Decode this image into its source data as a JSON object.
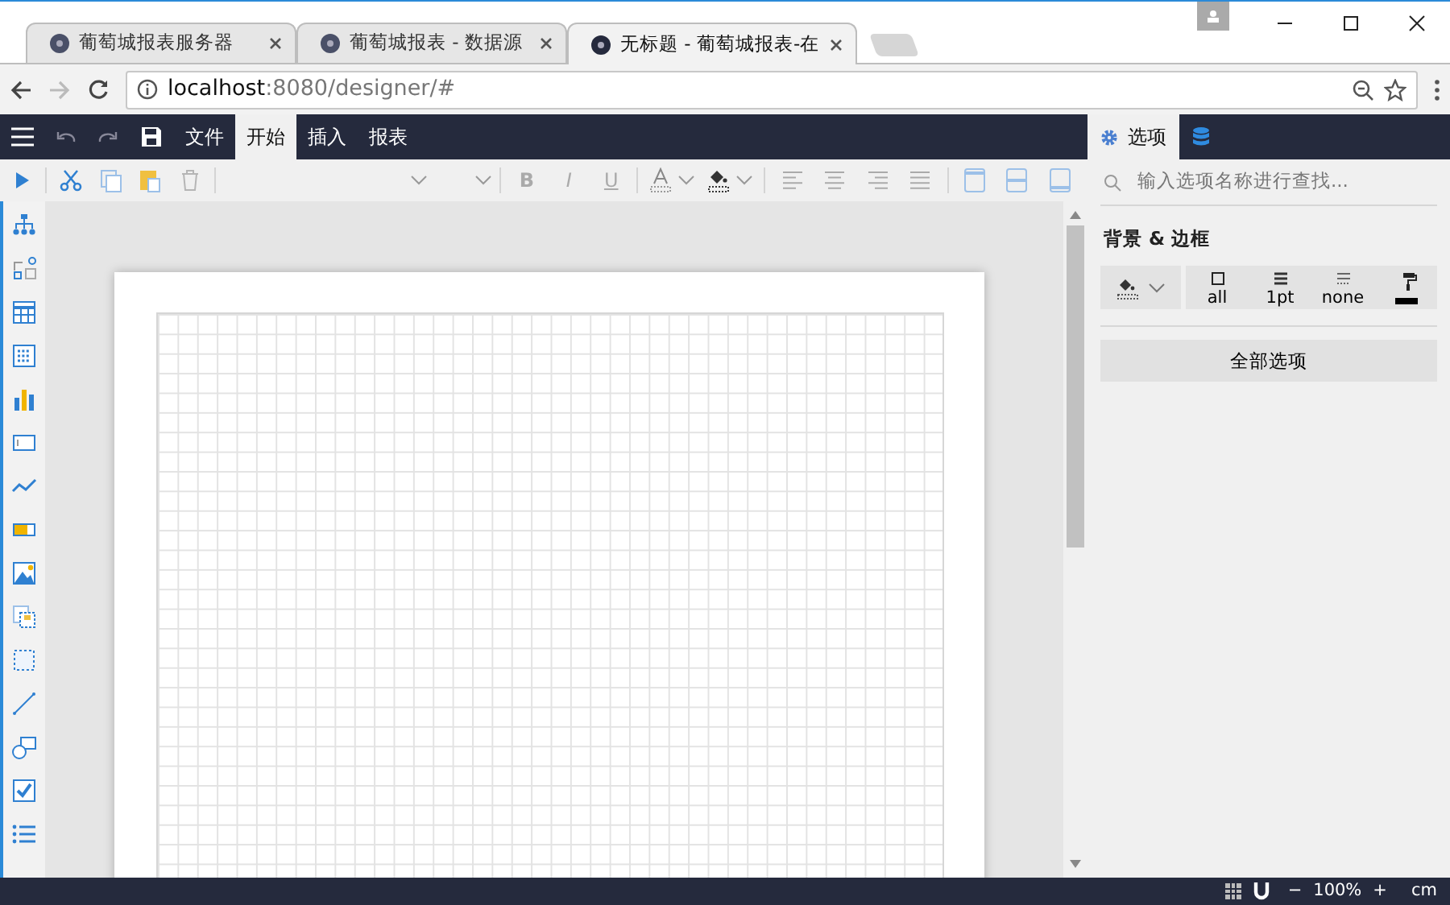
{
  "browser": {
    "tabs": [
      {
        "title": "葡萄城报表服务器",
        "selected": false
      },
      {
        "title": "葡萄城报表 - 数据源",
        "selected": false
      },
      {
        "title": "无标题 - 葡萄城报表-在",
        "selected": true
      }
    ],
    "url": {
      "host": "localhost",
      "path": ":8080/designer/#"
    }
  },
  "menu": [
    {
      "label": "文件",
      "selected": false
    },
    {
      "label": "开始",
      "selected": true
    },
    {
      "label": "插入",
      "selected": false
    },
    {
      "label": "报表",
      "selected": false
    }
  ],
  "text_style_buttons": [
    {
      "label": "B",
      "disabled": true
    },
    {
      "label": "I",
      "disabled": true
    },
    {
      "label": "U",
      "disabled": true
    }
  ],
  "panel_tabs": [
    {
      "kind": "options",
      "label": "选项",
      "selected": true
    },
    {
      "kind": "data",
      "selected": false
    }
  ],
  "panel": {
    "search_placeholder": "输入选项名称进行查找...",
    "section_title": "背景 & 边框",
    "border_buttons": [
      "all",
      "1pt",
      "none"
    ],
    "all_options_button": "全部选项"
  },
  "status_bar": {
    "zoom_out": "−",
    "zoom": "100%",
    "zoom_in": "+",
    "unit": "cm"
  }
}
